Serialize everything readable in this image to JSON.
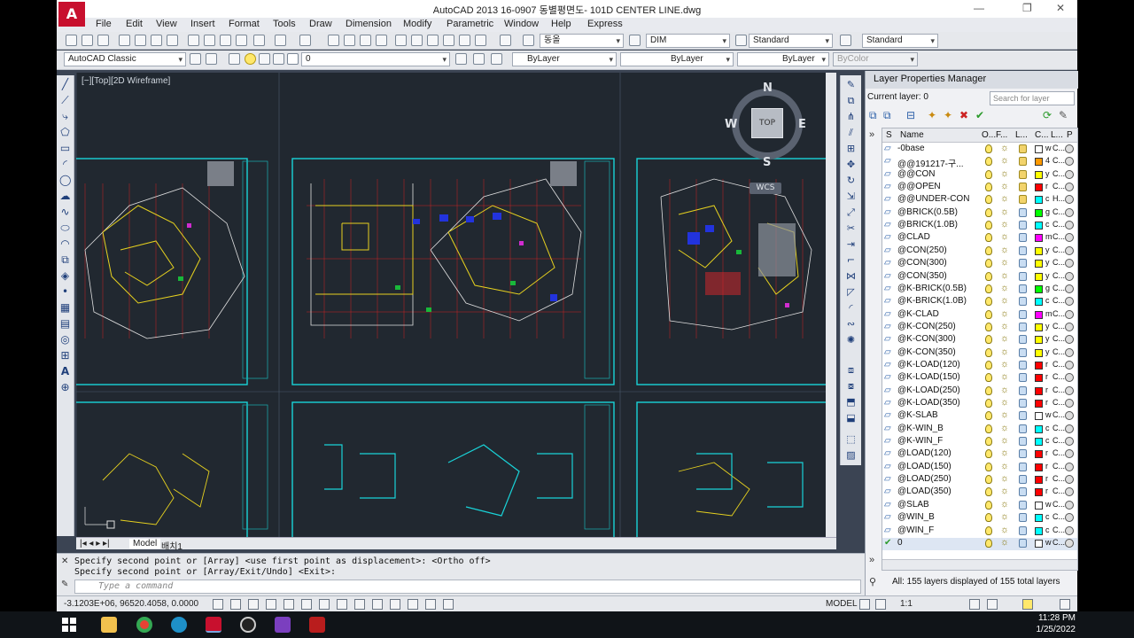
{
  "window": {
    "title": "AutoCAD 2013    16-0907 동별평면도- 101D  CENTER LINE.dwg",
    "app_logo": "A",
    "controls": [
      "—",
      "❐",
      "✕"
    ]
  },
  "menu": [
    "File",
    "Edit",
    "View",
    "Insert",
    "Format",
    "Tools",
    "Draw",
    "Dimension",
    "Modify",
    "Parametric",
    "Window",
    "Help",
    "Express"
  ],
  "toolbar1": {
    "text_style": "동올",
    "dim_style": "DIM",
    "table_style": "Standard",
    "multileader_style": "Standard"
  },
  "toolbar2": {
    "workspace": "AutoCAD Classic",
    "layer": "0",
    "color": "ByLayer",
    "linetype": "ByLayer",
    "lineweight": "ByLayer",
    "plotstyle": "ByColor"
  },
  "viewport": {
    "label": "[−][Top][2D Wireframe]",
    "viewcube": {
      "face": "TOP",
      "n": "N",
      "s": "S",
      "e": "E",
      "w": "W",
      "wcs": "WCS"
    }
  },
  "layout_tabs": {
    "model": "Model",
    "layout1": "배치1"
  },
  "command": {
    "history": [
      "Specify second point or [Array] <use first point as displacement>:  <Ortho off>",
      "Specify second point or [Array/Exit/Undo] <Exit>:"
    ],
    "placeholder": "Type a command"
  },
  "status": {
    "coords": "-3.1203E+06, 96520.4058, 0.0000",
    "model": "MODEL",
    "annoscale": "1:1"
  },
  "layer_panel": {
    "title": "Layer Properties Manager",
    "current_layer": "Current layer: 0",
    "search_placeholder": "Search for layer",
    "columns": [
      "S",
      "Name",
      "O...",
      "F...",
      "L...",
      "C...",
      "L...",
      "P"
    ],
    "layers": [
      {
        "name": "-0base",
        "locked": true,
        "color": "#ffffff",
        "cn": "w",
        "lt": "C..."
      },
      {
        "name": "@@191217-구...",
        "locked": true,
        "color": "#ff9900",
        "cn": "4",
        "lt": "C..."
      },
      {
        "name": "@@CON",
        "locked": true,
        "color": "#ffff00",
        "cn": "y",
        "lt": "C..."
      },
      {
        "name": "@@OPEN",
        "locked": true,
        "color": "#ff0000",
        "cn": "r",
        "lt": "C..."
      },
      {
        "name": "@@UNDER-CON",
        "locked": true,
        "color": "#00ffff",
        "cn": "c",
        "lt": "H..."
      },
      {
        "name": "@BRICK(0.5B)",
        "locked": false,
        "color": "#00ff00",
        "cn": "g",
        "lt": "C..."
      },
      {
        "name": "@BRICK(1.0B)",
        "locked": false,
        "color": "#00ffff",
        "cn": "c",
        "lt": "C..."
      },
      {
        "name": "@CLAD",
        "locked": false,
        "color": "#ff00ff",
        "cn": "m",
        "lt": "C..."
      },
      {
        "name": "@CON(250)",
        "locked": false,
        "color": "#ffff00",
        "cn": "y",
        "lt": "C..."
      },
      {
        "name": "@CON(300)",
        "locked": false,
        "color": "#ffff00",
        "cn": "y",
        "lt": "C..."
      },
      {
        "name": "@CON(350)",
        "locked": false,
        "color": "#ffff00",
        "cn": "y",
        "lt": "C..."
      },
      {
        "name": "@K-BRICK(0.5B)",
        "locked": false,
        "color": "#00ff00",
        "cn": "g",
        "lt": "C..."
      },
      {
        "name": "@K-BRICK(1.0B)",
        "locked": false,
        "color": "#00ffff",
        "cn": "c",
        "lt": "C..."
      },
      {
        "name": "@K-CLAD",
        "locked": false,
        "color": "#ff00ff",
        "cn": "m",
        "lt": "C..."
      },
      {
        "name": "@K-CON(250)",
        "locked": false,
        "color": "#ffff00",
        "cn": "y",
        "lt": "C..."
      },
      {
        "name": "@K-CON(300)",
        "locked": false,
        "color": "#ffff00",
        "cn": "y",
        "lt": "C..."
      },
      {
        "name": "@K-CON(350)",
        "locked": false,
        "color": "#ffff00",
        "cn": "y",
        "lt": "C..."
      },
      {
        "name": "@K-LOAD(120)",
        "locked": false,
        "color": "#ff0000",
        "cn": "r",
        "lt": "C..."
      },
      {
        "name": "@K-LOAD(150)",
        "locked": false,
        "color": "#ff0000",
        "cn": "r",
        "lt": "C..."
      },
      {
        "name": "@K-LOAD(250)",
        "locked": false,
        "color": "#ff0000",
        "cn": "r",
        "lt": "C..."
      },
      {
        "name": "@K-LOAD(350)",
        "locked": false,
        "color": "#ff0000",
        "cn": "r",
        "lt": "C..."
      },
      {
        "name": "@K-SLAB",
        "locked": false,
        "color": "#ffffff",
        "cn": "w",
        "lt": "C..."
      },
      {
        "name": "@K-WIN_B",
        "locked": false,
        "color": "#00ffff",
        "cn": "c",
        "lt": "C..."
      },
      {
        "name": "@K-WIN_F",
        "locked": false,
        "color": "#00ffff",
        "cn": "c",
        "lt": "C..."
      },
      {
        "name": "@LOAD(120)",
        "locked": false,
        "color": "#ff0000",
        "cn": "r",
        "lt": "C..."
      },
      {
        "name": "@LOAD(150)",
        "locked": false,
        "color": "#ff0000",
        "cn": "r",
        "lt": "C..."
      },
      {
        "name": "@LOAD(250)",
        "locked": false,
        "color": "#ff0000",
        "cn": "r",
        "lt": "C..."
      },
      {
        "name": "@LOAD(350)",
        "locked": false,
        "color": "#ff0000",
        "cn": "r",
        "lt": "C..."
      },
      {
        "name": "@SLAB",
        "locked": false,
        "color": "#ffffff",
        "cn": "w",
        "lt": "C..."
      },
      {
        "name": "@WIN_B",
        "locked": false,
        "color": "#00ffff",
        "cn": "c",
        "lt": "C..."
      },
      {
        "name": "@WIN_F",
        "locked": false,
        "color": "#00ffff",
        "cn": "c",
        "lt": "C..."
      },
      {
        "name": "0",
        "locked": false,
        "color": "#ffffff",
        "cn": "w",
        "lt": "C...",
        "current": true
      }
    ],
    "summary": "All: 155 layers displayed of 155 total layers"
  },
  "taskbar": {
    "time": "11:28 PM",
    "date": "1/25/2022",
    "apps": [
      "windows-start",
      "file-explorer",
      "chrome",
      "edge",
      "autocad",
      "obs",
      "mail-m",
      "app-g"
    ]
  }
}
